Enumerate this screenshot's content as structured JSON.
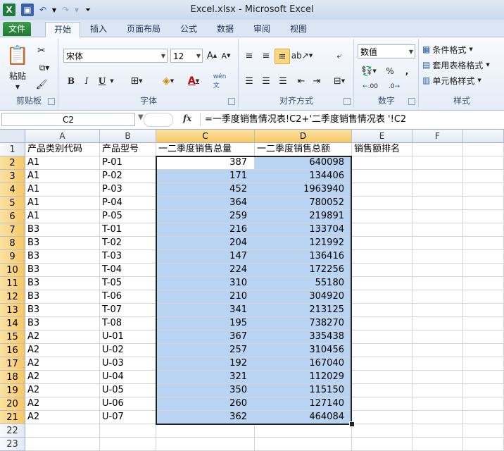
{
  "window": {
    "title": "Excel.xlsx - Microsoft Excel"
  },
  "tabs": [
    "文件",
    "开始",
    "插入",
    "页面布局",
    "公式",
    "数据",
    "审阅",
    "视图"
  ],
  "ribbon": {
    "clipboard": {
      "paste": "粘贴",
      "label": "剪贴板"
    },
    "font": {
      "name": "宋体",
      "size": "12",
      "label": "字体",
      "bold": "B",
      "italic": "I",
      "underline": "U"
    },
    "align": {
      "label": "对齐方式"
    },
    "number": {
      "format": "数值",
      "label": "数字",
      "percent": "%",
      "comma": ",",
      "inc": ".00",
      "dec": ".0"
    },
    "styles": {
      "cond": "条件格式",
      "table": "套用表格格式",
      "cell": "单元格样式",
      "label": "样式"
    }
  },
  "formula_bar": {
    "name_box": "C2",
    "fx": "fx",
    "formula": "=一季度销售情况表!C2+'二季度销售情况表 '!C2"
  },
  "grid": {
    "columns": [
      "A",
      "B",
      "C",
      "D",
      "E",
      "F"
    ],
    "headers": [
      "产品类别代码",
      "产品型号",
      "一二季度销售总量",
      "一二季度销售总额",
      "销售额排名"
    ],
    "rows": [
      [
        "A1",
        "P-01",
        "387",
        "640098"
      ],
      [
        "A1",
        "P-02",
        "171",
        "134406"
      ],
      [
        "A1",
        "P-03",
        "452",
        "1963940"
      ],
      [
        "A1",
        "P-04",
        "364",
        "780052"
      ],
      [
        "A1",
        "P-05",
        "259",
        "219891"
      ],
      [
        "B3",
        "T-01",
        "216",
        "133704"
      ],
      [
        "B3",
        "T-02",
        "204",
        "121992"
      ],
      [
        "B3",
        "T-03",
        "147",
        "136416"
      ],
      [
        "B3",
        "T-04",
        "224",
        "172256"
      ],
      [
        "B3",
        "T-05",
        "310",
        "55180"
      ],
      [
        "B3",
        "T-06",
        "210",
        "304920"
      ],
      [
        "B3",
        "T-07",
        "341",
        "213125"
      ],
      [
        "B3",
        "T-08",
        "195",
        "738270"
      ],
      [
        "A2",
        "U-01",
        "367",
        "335438"
      ],
      [
        "A2",
        "U-02",
        "257",
        "310456"
      ],
      [
        "A2",
        "U-03",
        "192",
        "167040"
      ],
      [
        "A2",
        "U-04",
        "321",
        "112029"
      ],
      [
        "A2",
        "U-05",
        "350",
        "115150"
      ],
      [
        "A2",
        "U-06",
        "260",
        "127140"
      ],
      [
        "A2",
        "U-07",
        "362",
        "464084"
      ]
    ],
    "row_numbers": [
      "1",
      "2",
      "3",
      "4",
      "5",
      "6",
      "7",
      "8",
      "9",
      "10",
      "11",
      "12",
      "13",
      "14",
      "15",
      "16",
      "17",
      "18",
      "19",
      "20",
      "21",
      "22",
      "23"
    ]
  },
  "colors": {
    "selection": "#b9d4f2",
    "header_highlight": "#f7c865",
    "excel_green": "#217a32"
  }
}
